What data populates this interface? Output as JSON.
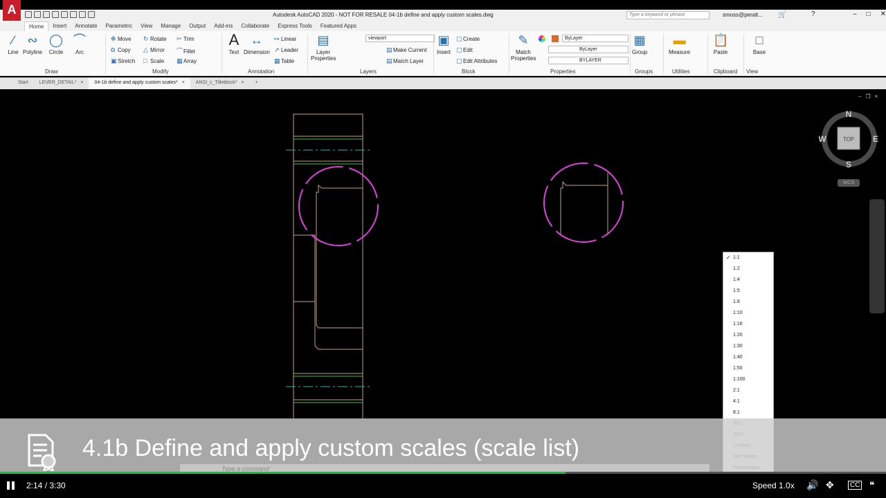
{
  "app": {
    "logo_letter": "A",
    "window_title": "Autodesk AutoCAD 2020 - NOT FOR RESALE    04-1b define and apply custom scales.dwg",
    "search_placeholder": "Type a keyword or phrase",
    "user": "smoss@peralt...",
    "icons": [
      "new-icon",
      "open-icon",
      "save-icon",
      "saveas-icon",
      "plot-icon",
      "undo-icon",
      "redo-icon",
      "share-icon",
      "cart-icon",
      "help-icon"
    ],
    "window_controls": [
      "–",
      "□",
      "✕"
    ]
  },
  "ribbon_tabs": [
    "Home",
    "Insert",
    "Annotate",
    "Parametric",
    "View",
    "Manage",
    "Output",
    "Add-ins",
    "Collaborate",
    "Express Tools",
    "Featured Apps"
  ],
  "ribbon": {
    "draw": {
      "label": "Draw",
      "tools": [
        "Line",
        "Polyline",
        "Circle",
        "Arc"
      ]
    },
    "modify": {
      "label": "Modify",
      "tools": [
        "Move",
        "Rotate",
        "Trim",
        "Copy",
        "Mirror",
        "Fillet",
        "Stretch",
        "Scale",
        "Array"
      ]
    },
    "annotation": {
      "label": "Annotation",
      "tools": [
        "Text",
        "Dimension",
        "Linear",
        "Leader",
        "Table"
      ]
    },
    "layers": {
      "label": "Layers",
      "layer_properties": "Layer Properties",
      "current_layer": "viewport",
      "tools": [
        "Make Current",
        "Match Layer"
      ]
    },
    "block": {
      "label": "Block",
      "insert": "Insert",
      "tools": [
        "Create",
        "Edit",
        "Edit Attributes"
      ]
    },
    "properties": {
      "label": "Properties",
      "match": "Match Properties",
      "color": "ByLayer",
      "linetype": "ByLayer",
      "lineweight": "BYLAYER"
    },
    "groups": {
      "label": "Groups",
      "tool": "Group"
    },
    "utilities": {
      "label": "Utilities",
      "tool": "Measure"
    },
    "clipboard": {
      "label": "Clipboard",
      "tool": "Paste"
    },
    "view": {
      "label": "View",
      "tool": "Base"
    }
  },
  "file_tabs": [
    {
      "label": "Start",
      "active": false
    },
    {
      "label": "LEVER_DETAIL*",
      "active": false
    },
    {
      "label": "04-1b define and apply custom scales*",
      "active": true
    },
    {
      "label": "ANSI_c_Titleblock*",
      "active": false
    }
  ],
  "viewcube": {
    "north": "N",
    "south": "S",
    "east": "E",
    "west": "W",
    "face": "TOP",
    "wcs": "WCS"
  },
  "scale_list": {
    "checked": "1:1",
    "items": [
      "1:1",
      "1:2",
      "1:4",
      "1:5",
      "1:8",
      "1:10",
      "1:16",
      "1:20",
      "1:30",
      "1:40",
      "1:50",
      "1:100",
      "2:1",
      "4:1",
      "8:1",
      "10:1",
      "100:1",
      "Custom...",
      "Xref scales",
      "Percentages"
    ]
  },
  "command_line": {
    "placeholder": "Type a command"
  },
  "video": {
    "title": "4.1b Define and apply custom scales (scale list)",
    "time": "2:14 / 3:30",
    "progress": 0.638,
    "speed": "Speed 1.0x",
    "accent": "#2fb34a"
  },
  "colors": {
    "cad_background": "#000000",
    "object_lines": "#c8a27a",
    "detail_circles": "#e040e0",
    "center_lines": "#2fb3b3",
    "green_lines": "#3fbf3f"
  }
}
